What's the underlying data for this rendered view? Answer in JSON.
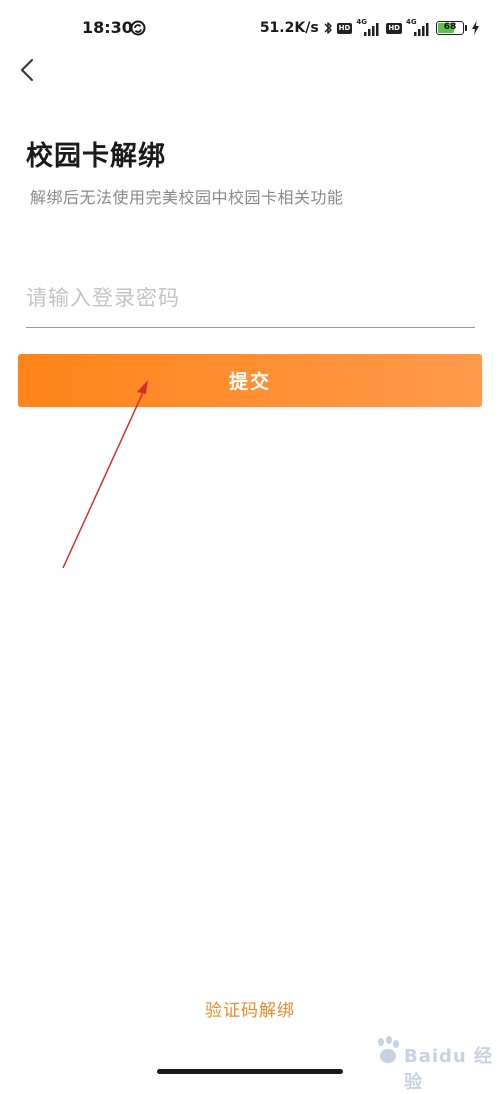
{
  "status_bar": {
    "time": "18:30",
    "network_speed": "51.2K/s",
    "hd_badge": "HD",
    "network_type_1": "4G",
    "network_type_2": "4G",
    "battery_level": "68",
    "battery_fraction": 0.68,
    "icons": [
      "sync-icon",
      "bluetooth-icon",
      "signal-icon",
      "battery-icon",
      "charging-icon"
    ]
  },
  "header": {
    "back_icon": "chevron-left-icon"
  },
  "main": {
    "title": "校园卡解绑",
    "subtitle": "解绑后无法使用完美校园中校园卡相关功能",
    "password_placeholder": "请输入登录密码",
    "password_value": "",
    "submit_label": "提交"
  },
  "footer": {
    "verify_code_link": "验证码解绑"
  },
  "colors": {
    "accent_start": "#ff8418",
    "accent_end": "#ff9a4c",
    "link": "#ef8a2a",
    "annotation": "#d0312d",
    "battery": "#5cc44a"
  },
  "watermark": {
    "text": "Baidu 经验"
  }
}
